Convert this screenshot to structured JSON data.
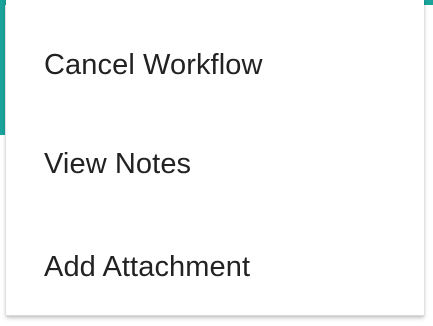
{
  "accent_color": "#1aa39b",
  "menu": {
    "items": [
      {
        "label": "Cancel Workflow"
      },
      {
        "label": "View Notes"
      },
      {
        "label": "Add Attachment"
      }
    ]
  }
}
